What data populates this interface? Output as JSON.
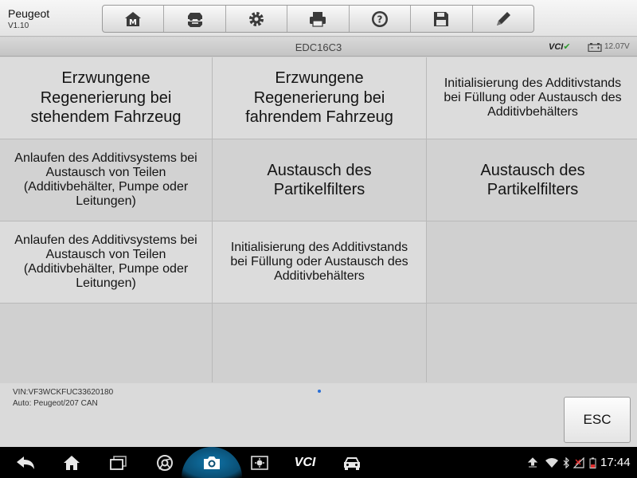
{
  "app": {
    "title": "Peugeot",
    "version": "V1.10"
  },
  "toolbar": {
    "buttons": [
      {
        "name": "home",
        "icon": "home-m-icon"
      },
      {
        "name": "vehicle-swap",
        "icon": "car-swap-icon"
      },
      {
        "name": "settings",
        "icon": "gear-icon"
      },
      {
        "name": "print",
        "icon": "printer-icon"
      },
      {
        "name": "help",
        "icon": "help-icon"
      },
      {
        "name": "save",
        "icon": "floppy-disk-icon"
      },
      {
        "name": "edit",
        "icon": "pencil-icon"
      }
    ]
  },
  "module": {
    "title": "EDC16C3",
    "vci": "VCI",
    "vci_check": "✔",
    "voltage": "12.07V"
  },
  "grid": {
    "cells": [
      "Erzwungene Regenerierung bei stehendem Fahrzeug",
      "Erzwungene Regenerierung bei fahrendem Fahrzeug",
      "Initialisierung des Additivstands bei Füllung oder Austausch des Additivbehälters",
      "Anlaufen des Additivsystems bei Austausch von Teilen (Additivbehälter, Pumpe oder Leitungen)",
      "Austausch des Partikelfilters",
      "Austausch des Partikelfilters",
      "Anlaufen des Additivsystems bei Austausch von Teilen (Additivbehälter, Pumpe oder Leitungen)",
      "Initialisierung des Additivstands bei Füllung oder Austausch des Additivbehälters"
    ]
  },
  "info": {
    "vin": "VIN:VF3WCKFUC33620180",
    "auto": "Auto: Peugeot/207 CAN"
  },
  "esc_label": "ESC",
  "navbar": {
    "vci_label": "VCI",
    "time": "17:44"
  },
  "colors": {
    "nav_background": "#000000",
    "camera_highlight": "#0f74a8",
    "vci_green": "#2e9a2e"
  }
}
